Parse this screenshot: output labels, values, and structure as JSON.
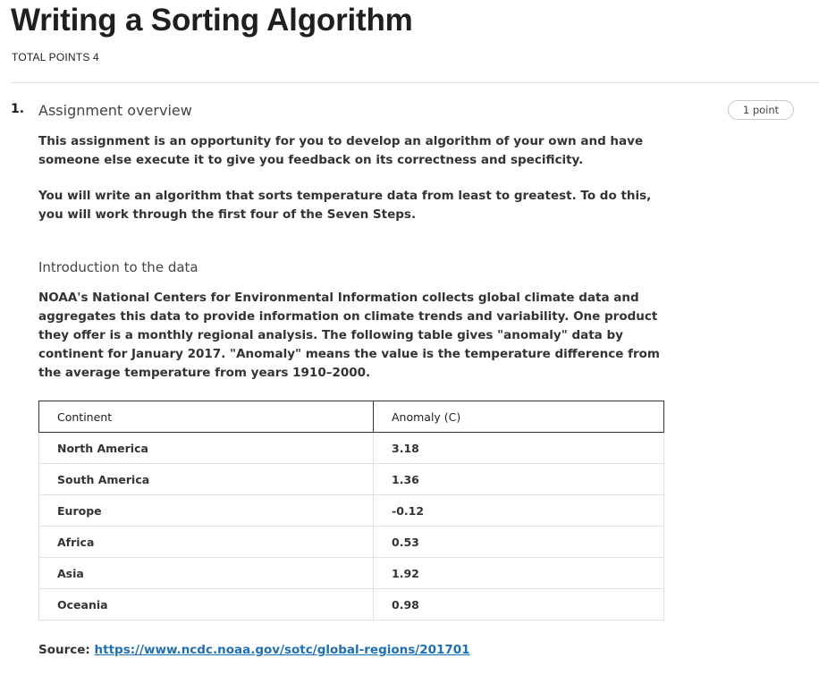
{
  "page": {
    "title": "Writing a Sorting Algorithm",
    "total_points": "TOTAL POINTS 4"
  },
  "question": {
    "number": "1.",
    "title": "Assignment overview",
    "points": "1 point",
    "paragraphs": [
      "This assignment is an opportunity for you to develop an algorithm of your own and have someone else execute it to give you feedback on its correctness and specificity.",
      "You will write an algorithm that sorts temperature data from least to greatest. To do this, you will work through the first four of the Seven Steps."
    ],
    "section_heading": "Introduction to the data",
    "intro_paragraph": "NOAA's National Centers for Environmental Information collects global climate data and aggregates this data to provide information on climate trends and variability. One product they offer is a monthly regional analysis. The following table gives \"anomaly\" data by continent for January 2017. \"Anomaly\" means the value is the temperature difference from the average temperature from years 1910–2000.",
    "table": {
      "headers": [
        "Continent",
        "Anomaly (C)"
      ],
      "rows": [
        [
          "North America",
          "3.18"
        ],
        [
          "South America",
          "1.36"
        ],
        [
          "Europe",
          "-0.12"
        ],
        [
          "Africa",
          "0.53"
        ],
        [
          "Asia",
          "1.92"
        ],
        [
          "Oceania",
          "0.98"
        ]
      ]
    },
    "source_label": "Source:",
    "source_link": "https://www.ncdc.noaa.gov/sotc/global-regions/201701"
  }
}
